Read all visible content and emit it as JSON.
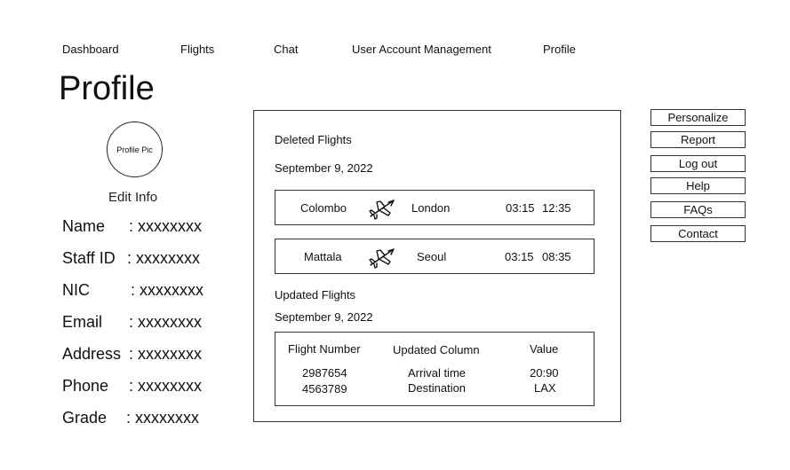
{
  "nav": {
    "items": [
      "Dashboard",
      "Flights",
      "Chat",
      "User Account Management",
      "Profile"
    ]
  },
  "page": {
    "title": "Profile",
    "avatar_text": "Profile Pic",
    "edit_info": "Edit Info"
  },
  "info": [
    {
      "label": "Name",
      "value": ": xxxxxxxx"
    },
    {
      "label": "Staff ID",
      "value": ": xxxxxxxx"
    },
    {
      "label": "NIC",
      "value": ": xxxxxxxx"
    },
    {
      "label": "Email",
      "value": ": xxxxxxxx"
    },
    {
      "label": "Address",
      "value": ": xxxxxxxx"
    },
    {
      "label": "Phone",
      "value": ": xxxxxxxx"
    },
    {
      "label": "Grade",
      "value": ": xxxxxxxx"
    }
  ],
  "deleted": {
    "title": "Deleted Flights",
    "date": "September 9, 2022",
    "flights": [
      {
        "from": "Colombo",
        "to": "London",
        "dep": "03:15",
        "arr": "12:35",
        "icon": "airplane-icon"
      },
      {
        "from": "Mattala",
        "to": "Seoul",
        "dep": "03:15",
        "arr": "08:35",
        "icon": "airplane-icon"
      }
    ]
  },
  "updated": {
    "title": "Updated Flights",
    "date": "September 9, 2022",
    "headers": [
      "Flight Number",
      "Updated Column",
      "Value"
    ],
    "rows": [
      [
        "2987654",
        "Arrival time",
        "20:90"
      ],
      [
        "4563789",
        "Destination",
        "LAX"
      ]
    ]
  },
  "side_buttons": [
    "Personalize",
    "Report",
    "Log out",
    "Help",
    "FAQs",
    "Contact"
  ]
}
